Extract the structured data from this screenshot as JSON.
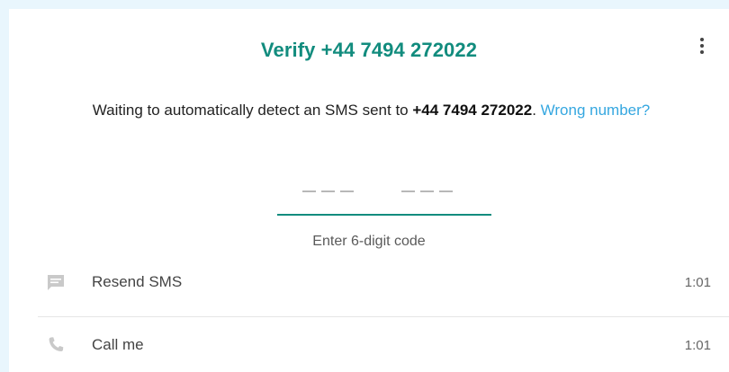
{
  "header": {
    "title": "Verify +44 7494 272022",
    "menu_icon": "more-vertical-icon"
  },
  "message": {
    "prefix": "Waiting to automatically detect an SMS sent to ",
    "phone": "+44 7494 272022",
    "suffix": ". ",
    "link": "Wrong number?"
  },
  "code": {
    "value": "",
    "hint": "Enter 6-digit code"
  },
  "actions": [
    {
      "label": "Resend SMS",
      "time": "1:01",
      "icon": "message-icon"
    },
    {
      "label": "Call me",
      "time": "1:01",
      "icon": "phone-icon"
    }
  ],
  "colors": {
    "accent": "#128c7e",
    "link": "#35a7e0",
    "background": "#e9f6fd"
  }
}
